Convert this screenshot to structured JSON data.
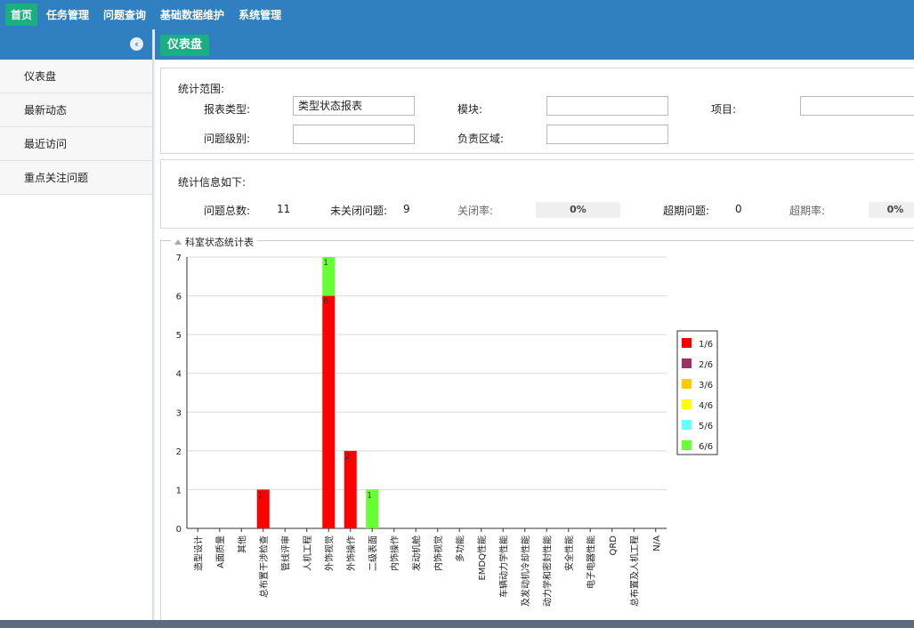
{
  "topnav": {
    "items": [
      {
        "label": "首页",
        "active": true
      },
      {
        "label": "任务管理",
        "active": false
      },
      {
        "label": "问题查询",
        "active": false
      },
      {
        "label": "基础数据维护",
        "active": false
      },
      {
        "label": "系统管理",
        "active": false
      }
    ]
  },
  "sidebar": {
    "collapse_icon": "chevron-left-icon",
    "items": [
      {
        "label": "仪表盘"
      },
      {
        "label": "最新动态"
      },
      {
        "label": "最近访问"
      },
      {
        "label": "重点关注问题"
      }
    ]
  },
  "main": {
    "tab_label": "仪表盘"
  },
  "filters": {
    "section_title": "统计范围:",
    "report_type_label": "报表类型:",
    "report_type_value": "类型状态报表",
    "module_label": "模块:",
    "module_value": "",
    "project_label": "项目:",
    "project_value": "",
    "level_label": "问题级别:",
    "level_value": "",
    "area_label": "负责区域:",
    "area_value": ""
  },
  "stats": {
    "section_title": "统计信息如下:",
    "total_label": "问题总数:",
    "total_value": "11",
    "open_label": "未关闭问题:",
    "open_value": "9",
    "close_rate_label": "关闭率:",
    "close_rate_value": "0%",
    "overdue_label": "超期问题:",
    "overdue_value": "0",
    "overdue_rate_label": "超期率:",
    "overdue_rate_value": "0%"
  },
  "chart_data": {
    "type": "bar",
    "title": "科室状态统计表",
    "stacked": true,
    "categories": [
      "造型设计",
      "A面质量",
      "其他",
      "总布置干涉检查",
      "管线评审",
      "人机工程",
      "外饰视觉",
      "外饰操作",
      "二级表面",
      "内饰操作",
      "发动机舱",
      "内饰视觉",
      "多功能",
      "EMDQ性能",
      "车辆动力学性能",
      "及发动机冷却性能",
      "动力学和密封性能",
      "安全性能",
      "电子电器性能",
      "QRD",
      "总布置及人机工程",
      "N/A"
    ],
    "series": [
      {
        "name": "1/6",
        "color": "#ff0000",
        "values": [
          0,
          0,
          0,
          1,
          0,
          0,
          6,
          2,
          0,
          0,
          0,
          0,
          0,
          0,
          0,
          0,
          0,
          0,
          0,
          0,
          0,
          0
        ]
      },
      {
        "name": "2/6",
        "color": "#993366",
        "values": [
          0,
          0,
          0,
          0,
          0,
          0,
          0,
          0,
          0,
          0,
          0,
          0,
          0,
          0,
          0,
          0,
          0,
          0,
          0,
          0,
          0,
          0
        ]
      },
      {
        "name": "3/6",
        "color": "#ffcc00",
        "values": [
          0,
          0,
          0,
          0,
          0,
          0,
          0,
          0,
          0,
          0,
          0,
          0,
          0,
          0,
          0,
          0,
          0,
          0,
          0,
          0,
          0,
          0
        ]
      },
      {
        "name": "4/6",
        "color": "#ffff00",
        "values": [
          0,
          0,
          0,
          0,
          0,
          0,
          0,
          0,
          0,
          0,
          0,
          0,
          0,
          0,
          0,
          0,
          0,
          0,
          0,
          0,
          0,
          0
        ]
      },
      {
        "name": "5/6",
        "color": "#66ffff",
        "values": [
          0,
          0,
          0,
          0,
          0,
          0,
          0,
          0,
          0,
          0,
          0,
          0,
          0,
          0,
          0,
          0,
          0,
          0,
          0,
          0,
          0,
          0
        ]
      },
      {
        "name": "6/6",
        "color": "#66ff33",
        "values": [
          0,
          0,
          0,
          0,
          0,
          0,
          1,
          0,
          1,
          0,
          0,
          0,
          0,
          0,
          0,
          0,
          0,
          0,
          0,
          0,
          0,
          0
        ]
      }
    ],
    "ylim": [
      0,
      7
    ],
    "yticks": [
      0,
      1,
      2,
      3,
      4,
      5,
      6,
      7
    ],
    "grid": true,
    "legend_position": "right"
  }
}
